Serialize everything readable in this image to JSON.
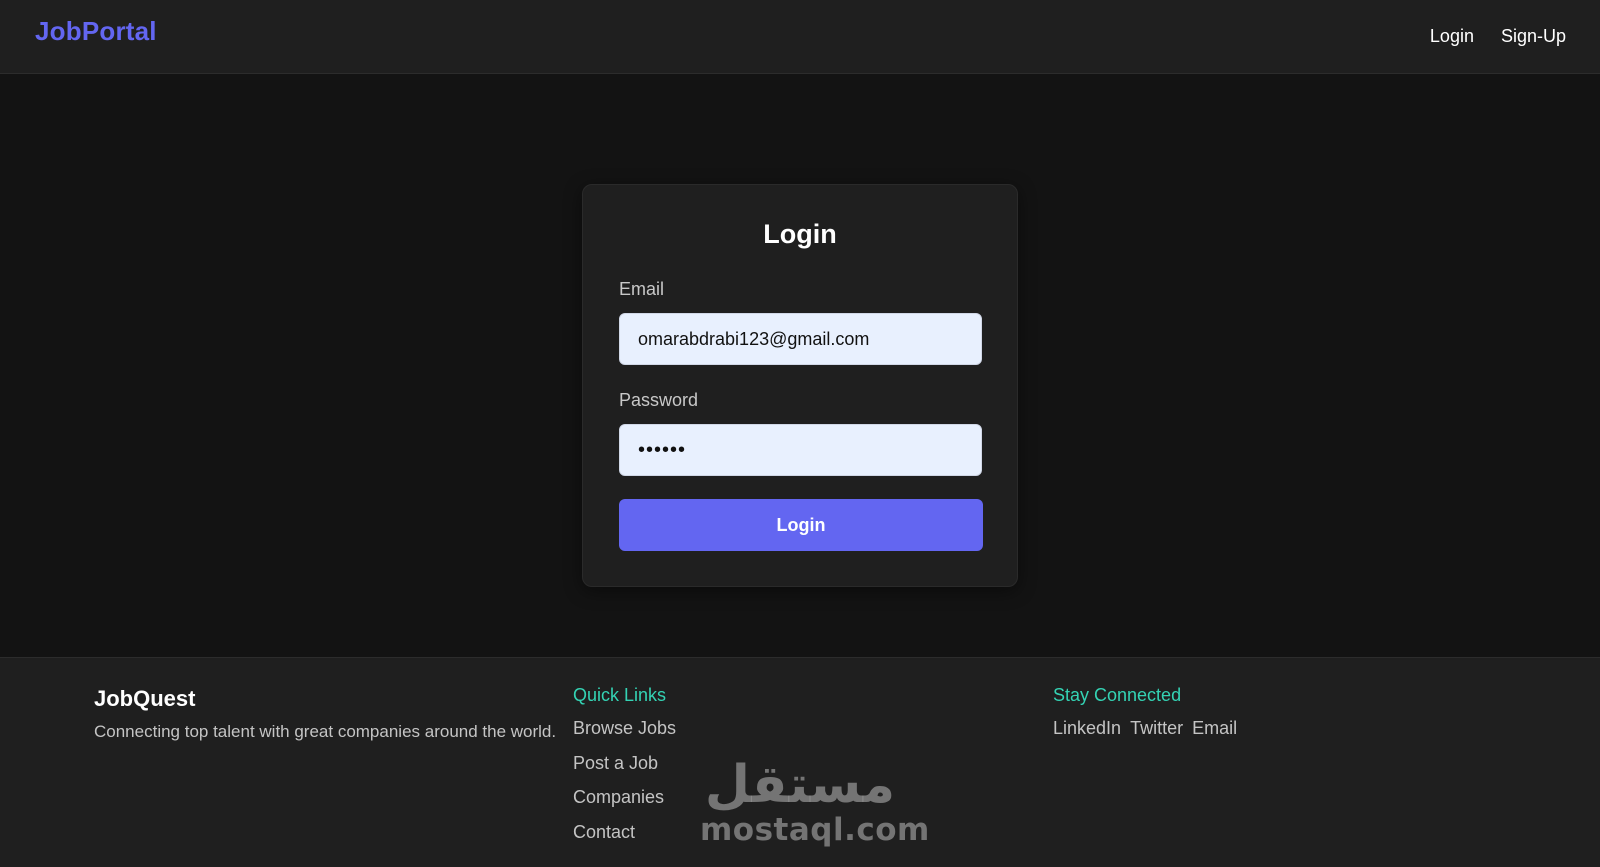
{
  "header": {
    "brand": "JobPortal",
    "nav": [
      {
        "label": "Login"
      },
      {
        "label": "Sign-Up"
      }
    ]
  },
  "login_form": {
    "title": "Login",
    "email": {
      "label": "Email",
      "value": "omarabdrabi123@gmail.com"
    },
    "password": {
      "label": "Password",
      "value": "••••••"
    },
    "submit_label": "Login"
  },
  "footer": {
    "brand": "JobQuest",
    "tagline": "Connecting top talent with great companies around the world.",
    "quick_links": {
      "heading": "Quick Links",
      "items": [
        "Browse Jobs",
        "Post a Job",
        "Companies",
        "Contact"
      ]
    },
    "stay_connected": {
      "heading": "Stay Connected",
      "items": [
        "LinkedIn",
        "Twitter",
        "Email"
      ]
    }
  },
  "watermark": {
    "arabic": "مستقل",
    "latin": "mostaql.com"
  },
  "colors": {
    "accent": "#6366f1",
    "teal": "#34d3b4",
    "background": "#131313",
    "surface": "#1f1f1f",
    "input_bg": "#e8f0fe"
  }
}
